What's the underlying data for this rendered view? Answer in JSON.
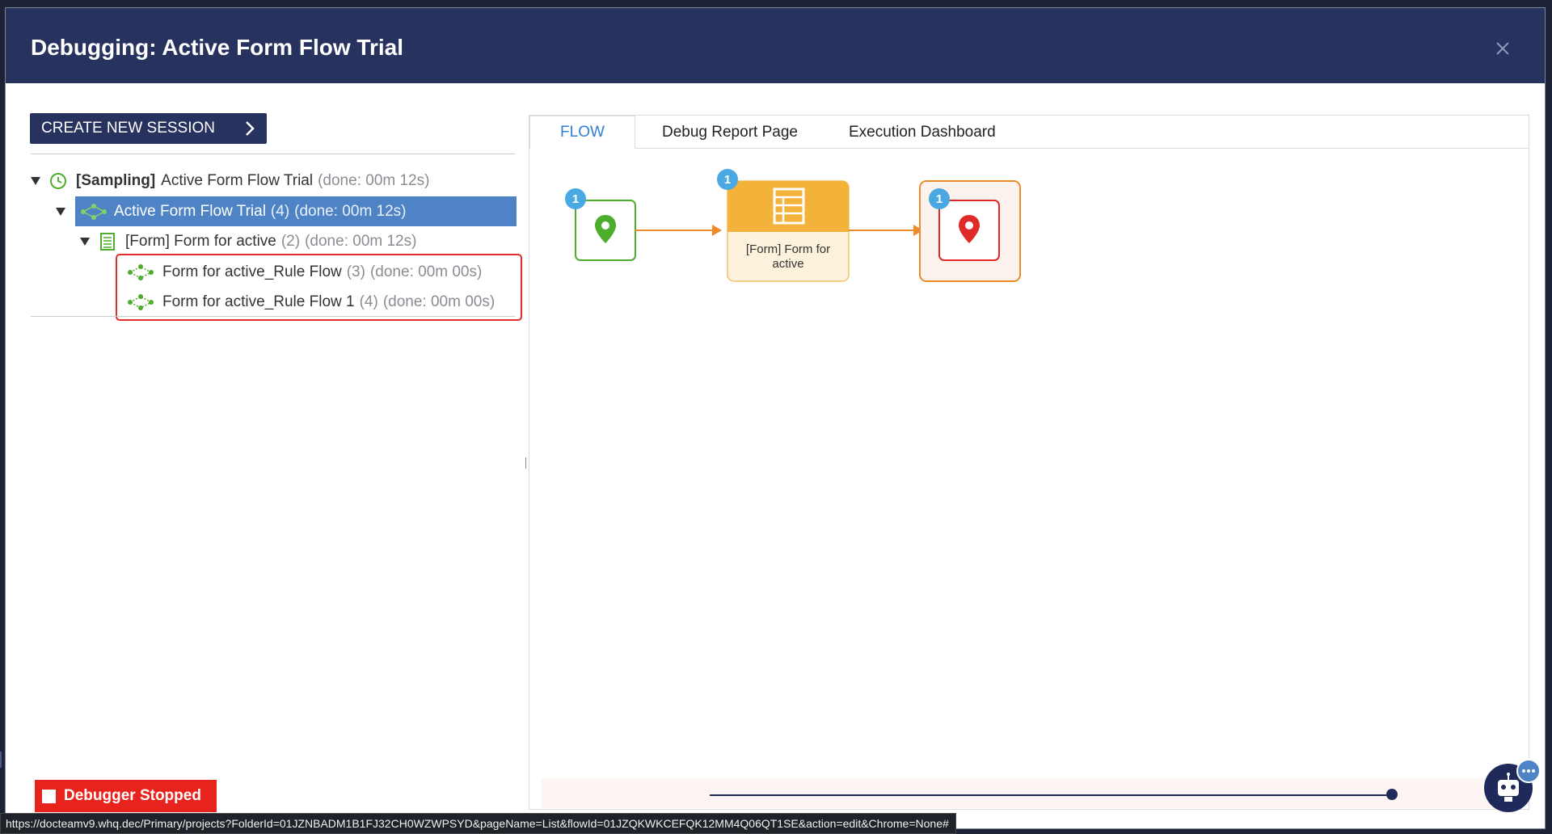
{
  "modal": {
    "title": "Debugging: Active Form Flow Trial",
    "close_icon": "close-icon"
  },
  "create_session": {
    "label": "CREATE NEW SESSION",
    "icon": "chevron-right-icon"
  },
  "tree": [
    {
      "prefix": "[Sampling]",
      "label": "Active Form Flow Trial",
      "count": "",
      "meta": "(done: 00m 12s)",
      "icon": "clock-icon",
      "expanded": true,
      "selected": false
    },
    {
      "prefix": "",
      "label": "Active Form Flow Trial",
      "count": "(4)",
      "meta": "(done: 00m 12s)",
      "icon": "flow-icon",
      "expanded": true,
      "selected": true
    },
    {
      "prefix": "",
      "label": "[Form] Form for active",
      "count": "(2)",
      "meta": "(done: 00m 12s)",
      "icon": "form-icon",
      "expanded": true,
      "selected": false
    },
    {
      "prefix": "",
      "label": "Form for active_Rule Flow",
      "count": "(3)",
      "meta": "(done: 00m 00s)",
      "icon": "rule-flow-icon",
      "expanded": false,
      "selected": false
    },
    {
      "prefix": "",
      "label": "Form for active_Rule Flow 1",
      "count": "(4)",
      "meta": "(done: 00m 00s)",
      "icon": "rule-flow-icon",
      "expanded": false,
      "selected": false
    }
  ],
  "tabs": [
    {
      "label": "FLOW",
      "active": true
    },
    {
      "label": "Debug Report Page",
      "active": false
    },
    {
      "label": "Execution Dashboard",
      "active": false
    }
  ],
  "flow": {
    "nodes": [
      {
        "type": "start",
        "badge": "1",
        "icon": "location-pin-icon",
        "color": "#4cae2c"
      },
      {
        "type": "form",
        "badge": "1",
        "label": "[Form] Form for active",
        "icon": "form-icon",
        "color": "#f3b23a"
      },
      {
        "type": "end",
        "badge": "1",
        "icon": "location-pin-icon",
        "color": "#e02a2a"
      }
    ],
    "connector_color": "#ee8a2a",
    "badge_color": "#4aa9e3"
  },
  "status": {
    "debugger": "Debugger Stopped",
    "url": "https://docteamv9.whq.dec/Primary/projects?FolderId=01JZNBADM1B1FJ32CH0WZWPSYD&pageName=List&flowId=01JZQKWKCEFQK12MM4Q06QT1SE&action=edit&Chrome=None#"
  },
  "colors": {
    "header": "#27325f",
    "selected_row": "#4e84c6",
    "active_tab": "#2f7ed8",
    "stopped": "#e8231e"
  }
}
